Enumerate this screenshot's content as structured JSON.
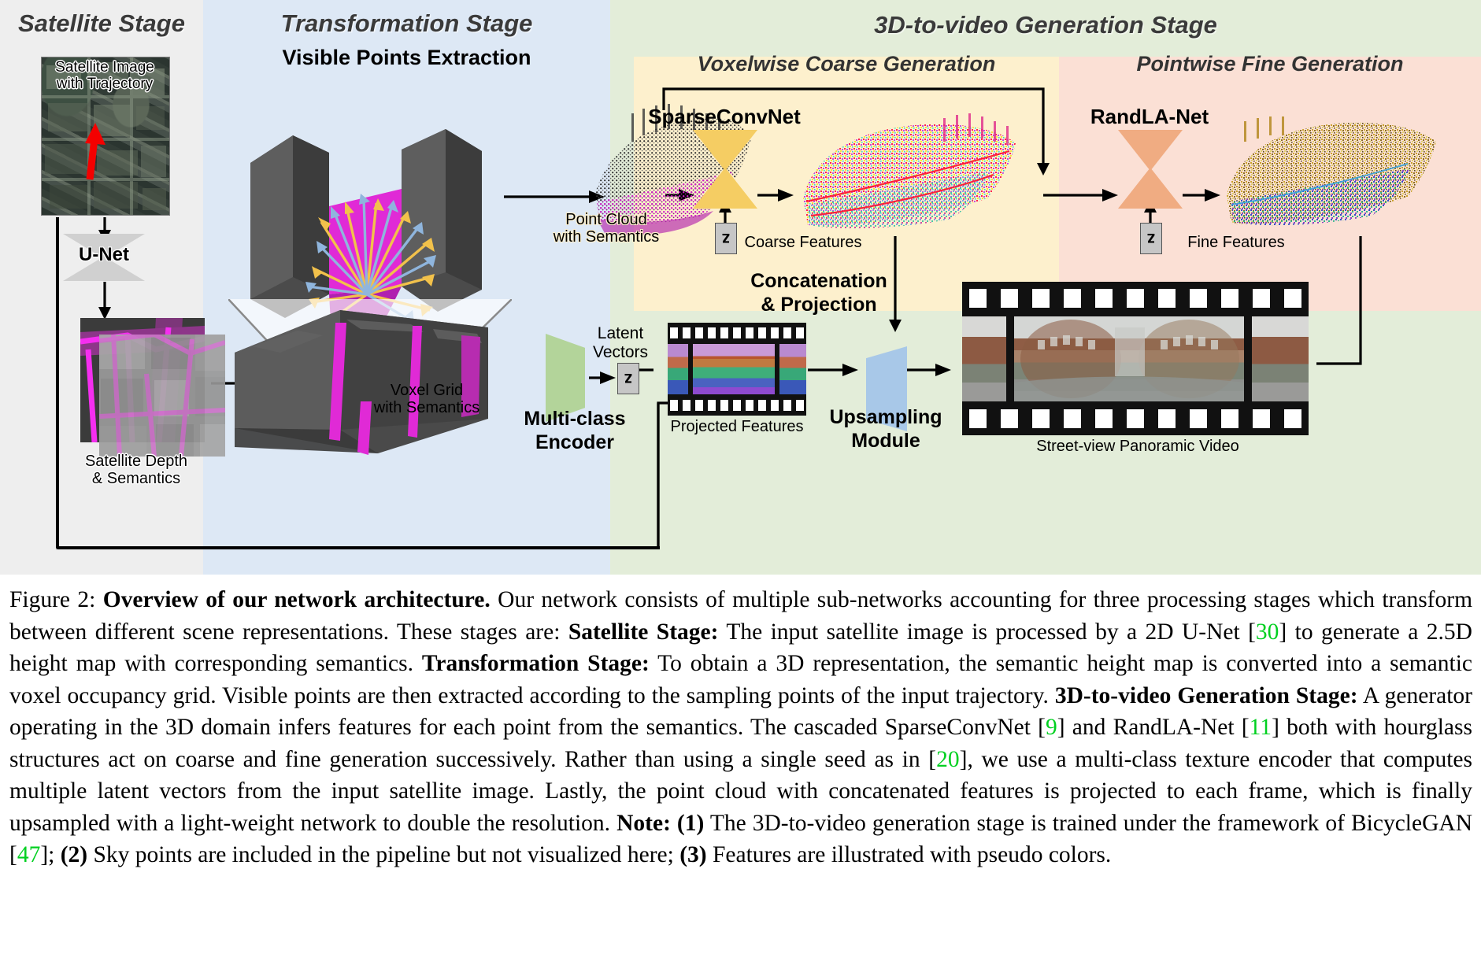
{
  "figure": {
    "number": "Figure 2:",
    "title": "Overview of our network architecture.",
    "caption_segments": [
      {
        "text": " Our network consists of multiple sub-networks accounting for three processing stages which transform between different scene representations. These stages are: ",
        "style": "normal"
      },
      {
        "text": "Satellite Stage:",
        "style": "bold"
      },
      {
        "text": " The input satellite image is processed by a 2D U-Net [",
        "style": "normal"
      },
      {
        "text": "30",
        "style": "cite"
      },
      {
        "text": "] to generate a 2.5D height map with corresponding semantics. ",
        "style": "normal"
      },
      {
        "text": "Transformation Stage:",
        "style": "bold"
      },
      {
        "text": " To obtain a 3D representation, the semantic height map is converted into a semantic voxel occupancy grid. Visible points are then extracted according to the sampling points of the input trajectory. ",
        "style": "normal"
      },
      {
        "text": "3D-to-video Generation Stage:",
        "style": "bold"
      },
      {
        "text": " A generator operating in the 3D domain infers features for each point from the semantics. The cascaded SparseConvNet [",
        "style": "normal"
      },
      {
        "text": "9",
        "style": "cite"
      },
      {
        "text": "] and RandLA-Net [",
        "style": "normal"
      },
      {
        "text": "11",
        "style": "cite"
      },
      {
        "text": "] both with hourglass structures act on coarse and fine generation successively. Rather than using a single seed as in [",
        "style": "normal"
      },
      {
        "text": "20",
        "style": "cite"
      },
      {
        "text": "], we use a multi-class texture encoder that computes multiple latent vectors from the input satellite image. Lastly, the point cloud with concatenated features is projected to each frame, which is finally upsampled with a light-weight network to double the resolution. ",
        "style": "normal"
      },
      {
        "text": "Note:",
        "style": "bold"
      },
      {
        "text": " ",
        "style": "normal"
      },
      {
        "text": "(1)",
        "style": "bold"
      },
      {
        "text": " The 3D-to-video generation stage is trained under the framework of BicycleGAN [",
        "style": "normal"
      },
      {
        "text": "47",
        "style": "cite"
      },
      {
        "text": "]; ",
        "style": "normal"
      },
      {
        "text": "(2)",
        "style": "bold"
      },
      {
        "text": " Sky points are included in the pipeline but not visualized here; ",
        "style": "normal"
      },
      {
        "text": "(3)",
        "style": "bold"
      },
      {
        "text": " Features are illustrated with pseudo colors.",
        "style": "normal"
      }
    ]
  },
  "stages": {
    "satellite": {
      "title": "Satellite Stage",
      "bg_color": "#eeeeee",
      "satellite_image_label": "Satellite Image\nwith Trajectory",
      "unet_label": "U-Net",
      "depth_label": "Satellite Depth\n& Semantics"
    },
    "transformation": {
      "title": "Transformation Stage",
      "bg_color": "#dde8f5",
      "section_title": "Visible Points Extraction",
      "voxel_label": "Voxel Grid\nwith Semantics"
    },
    "generation": {
      "title": "3D-to-video Generation Stage",
      "bg_color": "#e3edd9",
      "coarse": {
        "title": "Voxelwise Coarse Generation",
        "bg_color": "#fdf0cd",
        "network_name": "SparseConvNet",
        "network_color": "#f5cd63",
        "input_label": "Point Cloud\nwith Semantics",
        "output_label": "Coarse Features",
        "latent_symbol": "z"
      },
      "fine": {
        "title": "Pointwise Fine Generation",
        "bg_color": "#fbe0d5",
        "network_name": "RandLA-Net",
        "network_color": "#f0ac82",
        "output_label": "Fine Features",
        "latent_symbol": "z"
      },
      "encoder": {
        "name": "Multi-class\nEncoder",
        "color": "#b3d49a",
        "latent_label": "Latent\nVectors",
        "latent_symbol": "z"
      },
      "concatenation_label": "Concatenation\n& Projection",
      "projected_features_label": "Projected Features",
      "upsampling": {
        "name": "Upsampling\nModule",
        "color": "#a8c8e8"
      },
      "output_video_label": "Street-view Panoramic Video"
    }
  }
}
